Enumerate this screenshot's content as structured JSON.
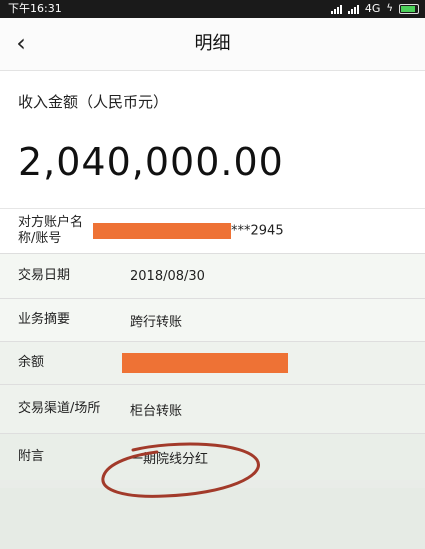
{
  "status": {
    "time": "下午16:31",
    "network": "4G"
  },
  "nav": {
    "title": "明细",
    "back_icon": "‹"
  },
  "amount": {
    "label": "收入金额（人民币元）",
    "value": "2,040,000.00"
  },
  "fields": {
    "account": {
      "label": "对方账户名称/账号",
      "suffix": "***2945"
    },
    "date": {
      "label": "交易日期",
      "value": "2018/08/30"
    },
    "summary": {
      "label": "业务摘要",
      "value": "跨行转账"
    },
    "balance": {
      "label": "余额"
    },
    "channel": {
      "label": "交易渠道/场所",
      "value": "柜台转账"
    },
    "note": {
      "label": "附言",
      "value": "一期院线分红"
    }
  },
  "colors": {
    "redaction": "#ee7235",
    "annotation": "#a23a2a"
  }
}
